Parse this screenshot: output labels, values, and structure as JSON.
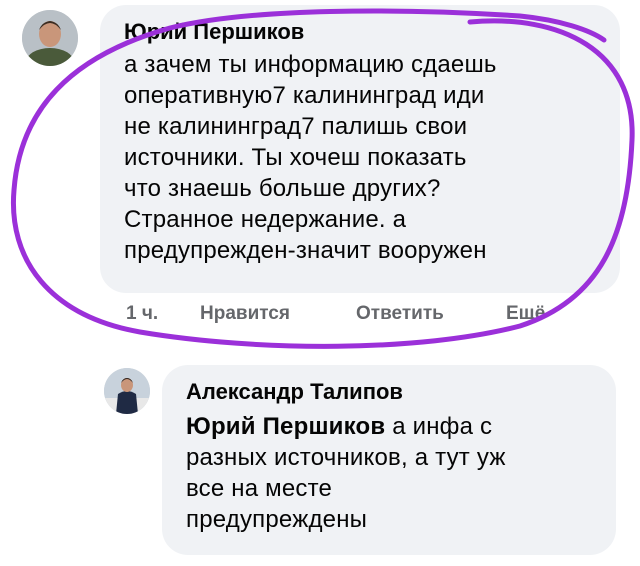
{
  "comments": [
    {
      "author": "Юрий Першиков",
      "avatar_icon": "user-avatar-photo",
      "text_lines": [
        "а зачем ты информацию сдаешь",
        "оперативную7 калининград иди",
        "не калининград7 палишь свои",
        "источники. Ты хочеш показать",
        "что знаешь больше других?",
        "Странное недержание. а",
        "предупрежден-значит вооружен"
      ],
      "actions": {
        "time": "1 ч.",
        "like": "Нравится",
        "reply": "Ответить",
        "more": "Ещё"
      }
    },
    {
      "author": "Александр Талипов",
      "avatar_icon": "user-avatar-photo",
      "mention": "Юрий Першиков",
      "text_first": "а инфа с",
      "text_lines": [
        "разных источников, а тут уж",
        "все на месте",
        "предупреждены"
      ]
    }
  ],
  "colors": {
    "bubble": "#f0f2f5",
    "meta": "#65676b",
    "annotation": "#9b30d9"
  }
}
